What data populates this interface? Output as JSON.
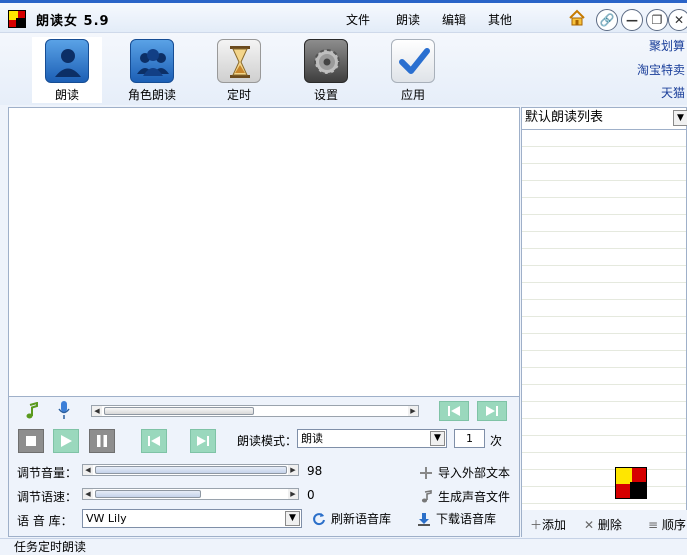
{
  "app": {
    "title": "朗读女 5.9"
  },
  "menu": [
    "文件",
    "朗读",
    "编辑",
    "其他"
  ],
  "window_buttons": {
    "link": "link-icon",
    "minimize": "minimize-icon",
    "maximize": "maximize-icon",
    "close": "close-icon"
  },
  "toolbar": {
    "items": [
      {
        "label": "朗读",
        "icon": "person-icon"
      },
      {
        "label": "角色朗读",
        "icon": "people-icon"
      },
      {
        "label": "定时",
        "icon": "hourglass-icon"
      },
      {
        "label": "设置",
        "icon": "gear-icon"
      },
      {
        "label": "应用",
        "icon": "checkmark-icon"
      }
    ],
    "side_links": [
      "聚划算",
      "淘宝特卖",
      "天猫"
    ]
  },
  "controls": {
    "reading_mode_label": "朗读模式：",
    "reading_mode_value": "朗读",
    "repeat_count": "1",
    "repeat_unit": "次",
    "volume_label": "调节音量：",
    "volume_value": "98",
    "speed_label": "调节语速：",
    "speed_value": "0",
    "voice_label": "语 音 库：",
    "voice_value": "VW Lily",
    "refresh_voices": "刷新语音库",
    "download_voices": "下载语音库",
    "import_text": "导入外部文本",
    "generate_audio": "生成声音文件"
  },
  "playlist": {
    "title": "默认朗读列表",
    "add": "添加",
    "delete": "删除",
    "order": "顺序"
  },
  "status": {
    "text": "任务定时朗读"
  },
  "colors": {
    "accent_green": "#9ad8bd",
    "brand_red": "#d60000",
    "link_blue": "#1b3f9a"
  }
}
